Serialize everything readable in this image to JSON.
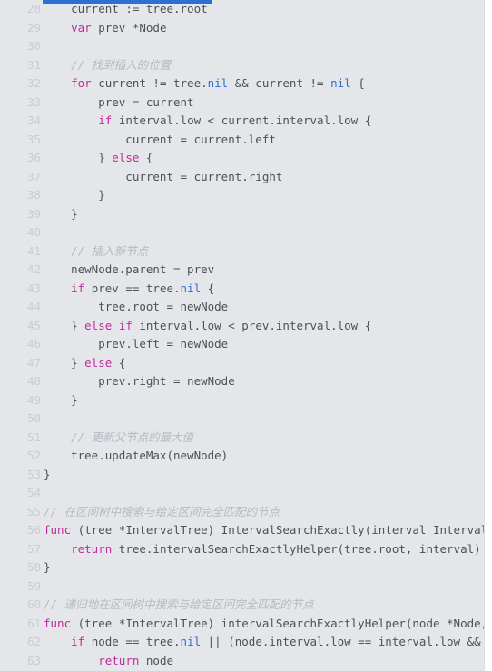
{
  "editor": {
    "language": "Go",
    "font_size_px": 12.5,
    "line_height_px": 20.5,
    "background_color": "#e4e6e9",
    "gutter_color": "#c9ccd1",
    "first_visible_line": 28,
    "last_visible_line": 63
  },
  "colors": {
    "keyword": "#bf2d9c",
    "builtin_nil": "#2f6fd0",
    "identifier": "#4c5159",
    "comment": "#b6bac1",
    "selection": "#2f6fd0",
    "scrollbar_track": "#ffffff"
  },
  "selection_sliver": {
    "present": true,
    "description": "blue selected-line sliver clipped at top of viewport"
  },
  "lines": [
    {
      "number": "28",
      "tokens": [
        {
          "t": "    ",
          "c": "pun"
        },
        {
          "t": "current := tree.root",
          "c": "id"
        }
      ]
    },
    {
      "number": "29",
      "tokens": [
        {
          "t": "    ",
          "c": "pun"
        },
        {
          "t": "var",
          "c": "kw"
        },
        {
          "t": " prev *Node",
          "c": "id"
        }
      ]
    },
    {
      "number": "30",
      "tokens": []
    },
    {
      "number": "31",
      "tokens": [
        {
          "t": "    ",
          "c": "pun"
        },
        {
          "t": "// 找到插入的位置",
          "c": "cmt"
        }
      ]
    },
    {
      "number": "32",
      "tokens": [
        {
          "t": "    ",
          "c": "pun"
        },
        {
          "t": "for",
          "c": "kw"
        },
        {
          "t": " current != tree.",
          "c": "id"
        },
        {
          "t": "nil",
          "c": "nil"
        },
        {
          "t": " && current != ",
          "c": "id"
        },
        {
          "t": "nil",
          "c": "nil"
        },
        {
          "t": " {",
          "c": "id"
        }
      ]
    },
    {
      "number": "33",
      "tokens": [
        {
          "t": "        prev = current",
          "c": "id"
        }
      ]
    },
    {
      "number": "34",
      "tokens": [
        {
          "t": "        ",
          "c": "pun"
        },
        {
          "t": "if",
          "c": "kw"
        },
        {
          "t": " interval.low < current.interval.low {",
          "c": "id"
        }
      ]
    },
    {
      "number": "35",
      "tokens": [
        {
          "t": "            current = current.left",
          "c": "id"
        }
      ]
    },
    {
      "number": "36",
      "tokens": [
        {
          "t": "        } ",
          "c": "id"
        },
        {
          "t": "else",
          "c": "kw"
        },
        {
          "t": " {",
          "c": "id"
        }
      ]
    },
    {
      "number": "37",
      "tokens": [
        {
          "t": "            current = current.right",
          "c": "id"
        }
      ]
    },
    {
      "number": "38",
      "tokens": [
        {
          "t": "        }",
          "c": "id"
        }
      ]
    },
    {
      "number": "39",
      "tokens": [
        {
          "t": "    }",
          "c": "id"
        }
      ]
    },
    {
      "number": "40",
      "tokens": []
    },
    {
      "number": "41",
      "tokens": [
        {
          "t": "    ",
          "c": "pun"
        },
        {
          "t": "// 插入新节点",
          "c": "cmt"
        }
      ]
    },
    {
      "number": "42",
      "tokens": [
        {
          "t": "    newNode.parent = prev",
          "c": "id"
        }
      ]
    },
    {
      "number": "43",
      "tokens": [
        {
          "t": "    ",
          "c": "pun"
        },
        {
          "t": "if",
          "c": "kw"
        },
        {
          "t": " prev == tree.",
          "c": "id"
        },
        {
          "t": "nil",
          "c": "nil"
        },
        {
          "t": " {",
          "c": "id"
        }
      ]
    },
    {
      "number": "44",
      "tokens": [
        {
          "t": "        tree.root = newNode",
          "c": "id"
        }
      ]
    },
    {
      "number": "45",
      "tokens": [
        {
          "t": "    } ",
          "c": "id"
        },
        {
          "t": "else",
          "c": "kw"
        },
        {
          "t": " ",
          "c": "id"
        },
        {
          "t": "if",
          "c": "kw"
        },
        {
          "t": " interval.low < prev.interval.low {",
          "c": "id"
        }
      ]
    },
    {
      "number": "46",
      "tokens": [
        {
          "t": "        prev.left = newNode",
          "c": "id"
        }
      ]
    },
    {
      "number": "47",
      "tokens": [
        {
          "t": "    } ",
          "c": "id"
        },
        {
          "t": "else",
          "c": "kw"
        },
        {
          "t": " {",
          "c": "id"
        }
      ]
    },
    {
      "number": "48",
      "tokens": [
        {
          "t": "        prev.right = newNode",
          "c": "id"
        }
      ]
    },
    {
      "number": "49",
      "tokens": [
        {
          "t": "    }",
          "c": "id"
        }
      ]
    },
    {
      "number": "50",
      "tokens": []
    },
    {
      "number": "51",
      "tokens": [
        {
          "t": "    ",
          "c": "pun"
        },
        {
          "t": "// 更新父节点的最大值",
          "c": "cmt"
        }
      ]
    },
    {
      "number": "52",
      "tokens": [
        {
          "t": "    tree.updateMax(newNode)",
          "c": "id"
        }
      ]
    },
    {
      "number": "53",
      "tokens": [
        {
          "t": "}",
          "c": "id"
        }
      ]
    },
    {
      "number": "54",
      "tokens": []
    },
    {
      "number": "55",
      "tokens": [
        {
          "t": "// 在区间树中搜索与给定区间完全匹配的节点",
          "c": "cmt"
        }
      ]
    },
    {
      "number": "56",
      "tokens": [
        {
          "t": "func",
          "c": "kw"
        },
        {
          "t": " (tree *IntervalTree) IntervalSearchExactly(interval Interval) *Node {",
          "c": "id"
        }
      ]
    },
    {
      "number": "57",
      "tokens": [
        {
          "t": "    ",
          "c": "pun"
        },
        {
          "t": "return",
          "c": "kw"
        },
        {
          "t": " tree.intervalSearchExactlyHelper(tree.root, interval)",
          "c": "id"
        }
      ]
    },
    {
      "number": "58",
      "tokens": [
        {
          "t": "}",
          "c": "id"
        }
      ]
    },
    {
      "number": "59",
      "tokens": []
    },
    {
      "number": "60",
      "tokens": [
        {
          "t": "// 递归地在区间树中搜索与给定区间完全匹配的节点",
          "c": "cmt"
        }
      ]
    },
    {
      "number": "61",
      "tokens": [
        {
          "t": "func",
          "c": "kw"
        },
        {
          "t": " (tree *IntervalTree) intervalSearchExactlyHelper(node *Node, interval Interval) *Node {",
          "c": "id"
        }
      ]
    },
    {
      "number": "62",
      "tokens": [
        {
          "t": "    ",
          "c": "pun"
        },
        {
          "t": "if",
          "c": "kw"
        },
        {
          "t": " node == tree.",
          "c": "id"
        },
        {
          "t": "nil",
          "c": "nil"
        },
        {
          "t": " || (node.interval.low == interval.low && node.interval.high == interval.high) {",
          "c": "id"
        }
      ]
    },
    {
      "number": "63",
      "tokens": [
        {
          "t": "        ",
          "c": "pun"
        },
        {
          "t": "return",
          "c": "kw"
        },
        {
          "t": " node",
          "c": "id"
        }
      ]
    }
  ]
}
